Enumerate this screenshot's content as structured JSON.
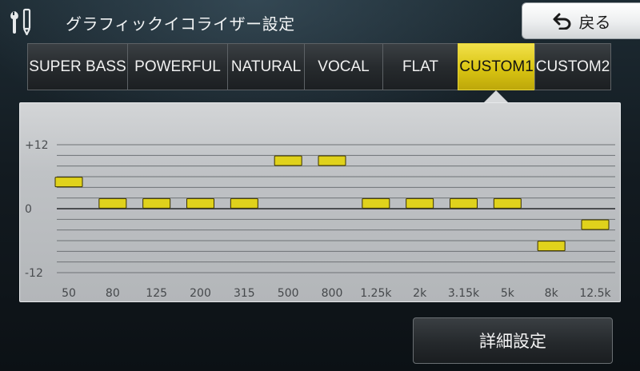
{
  "header": {
    "title": "グラフィックイコライザー設定",
    "back_label": "戻る",
    "tools_icon": "wrench-pencil-icon",
    "back_icon": "return-arrow-icon"
  },
  "presets": {
    "items": [
      {
        "label": "SUPER BASS",
        "active": false
      },
      {
        "label": "POWERFUL",
        "active": false
      },
      {
        "label": "NATURAL",
        "active": false
      },
      {
        "label": "VOCAL",
        "active": false
      },
      {
        "label": "FLAT",
        "active": false
      },
      {
        "label": "CUSTOM1",
        "active": true
      },
      {
        "label": "CUSTOM2",
        "active": false
      }
    ]
  },
  "equalizer": {
    "y_labels": {
      "top": "+12",
      "mid": "0",
      "bottom": "-12"
    },
    "range": [
      -12,
      12
    ],
    "bands": [
      {
        "freq": "50",
        "gain": 5
      },
      {
        "freq": "80",
        "gain": 1
      },
      {
        "freq": "125",
        "gain": 1
      },
      {
        "freq": "200",
        "gain": 1
      },
      {
        "freq": "315",
        "gain": 1
      },
      {
        "freq": "500",
        "gain": 9
      },
      {
        "freq": "800",
        "gain": 9
      },
      {
        "freq": "1.25k",
        "gain": 1
      },
      {
        "freq": "2k",
        "gain": 1
      },
      {
        "freq": "3.15k",
        "gain": 1
      },
      {
        "freq": "5k",
        "gain": 1
      },
      {
        "freq": "8k",
        "gain": -7
      },
      {
        "freq": "12.5k",
        "gain": -3
      }
    ],
    "colors": {
      "slider": "#e0d21c",
      "slider_border": "#3a3200",
      "zero_line": "#4a4d50",
      "grid": "#6e7276"
    }
  },
  "footer": {
    "detail_label": "詳細設定"
  }
}
